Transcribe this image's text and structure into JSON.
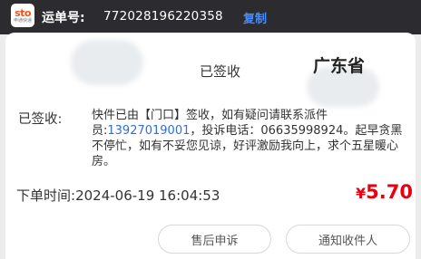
{
  "header": {
    "logo_text": "sto",
    "logo_subtext": "申通快递",
    "waybill_label": "运单号:",
    "waybill_number": "772028196220358",
    "copy_label": "复制"
  },
  "route": {
    "status": "已签收",
    "destination": "广东省"
  },
  "sign": {
    "label": "已签收:",
    "text_before_phone": "快件已由【门口】签收，如有疑问请联系派件员:",
    "courier_phone": "13927019001",
    "text_after_phone": "，投诉电话：06635998924。起早贪黑不停忙，如有不妥您见谅，好评激励我向上，求个五星暖心房。"
  },
  "order": {
    "time_label": "下单时间:",
    "time_value": "2024-06-19 16:04:53",
    "currency": "¥",
    "price": "5.70"
  },
  "actions": {
    "complaint": "售后申诉",
    "notify": "通知收件人"
  },
  "colors": {
    "header_bg": "#2c2c30",
    "accent_blue": "#4a8cf7",
    "price_red": "#e60012",
    "phone_blue": "#2f6fd6"
  }
}
